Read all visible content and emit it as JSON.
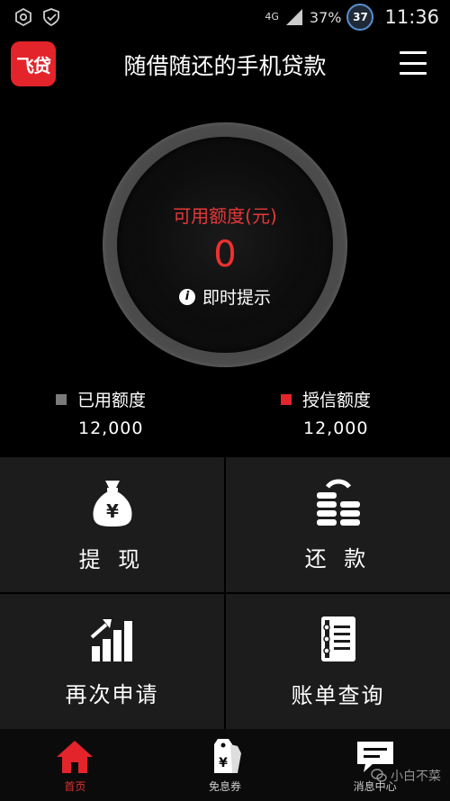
{
  "status_bar": {
    "network": "4G",
    "battery": "37%",
    "notification_badge": "37",
    "time": "11:36"
  },
  "header": {
    "logo_text": "飞贷",
    "title": "随借随还的手机贷款"
  },
  "credit": {
    "label": "可用额度(元)",
    "value": "0",
    "hint": "即时提示"
  },
  "legend": {
    "used": {
      "label": "已用额度",
      "amount": "12,000",
      "color": "#7a7a7a"
    },
    "granted": {
      "label": "授信额度",
      "amount": "12,000",
      "color": "#e3242b"
    }
  },
  "actions": [
    {
      "label": "提 现",
      "icon": "money-bag-icon"
    },
    {
      "label": "还 款",
      "icon": "coin-stack-icon"
    },
    {
      "label": "再次申请",
      "icon": "bar-chart-icon"
    },
    {
      "label": "账单查询",
      "icon": "notebook-icon"
    }
  ],
  "bottom_nav": [
    {
      "label": "首页",
      "icon": "home-icon",
      "active": true
    },
    {
      "label": "免息券",
      "icon": "price-tag-icon",
      "active": false
    },
    {
      "label": "消息中心",
      "icon": "message-icon",
      "active": false
    }
  ],
  "watermark": "小白不菜",
  "colors": {
    "accent": "#e3242b",
    "background": "#000000",
    "tile": "#1c1c1c"
  }
}
